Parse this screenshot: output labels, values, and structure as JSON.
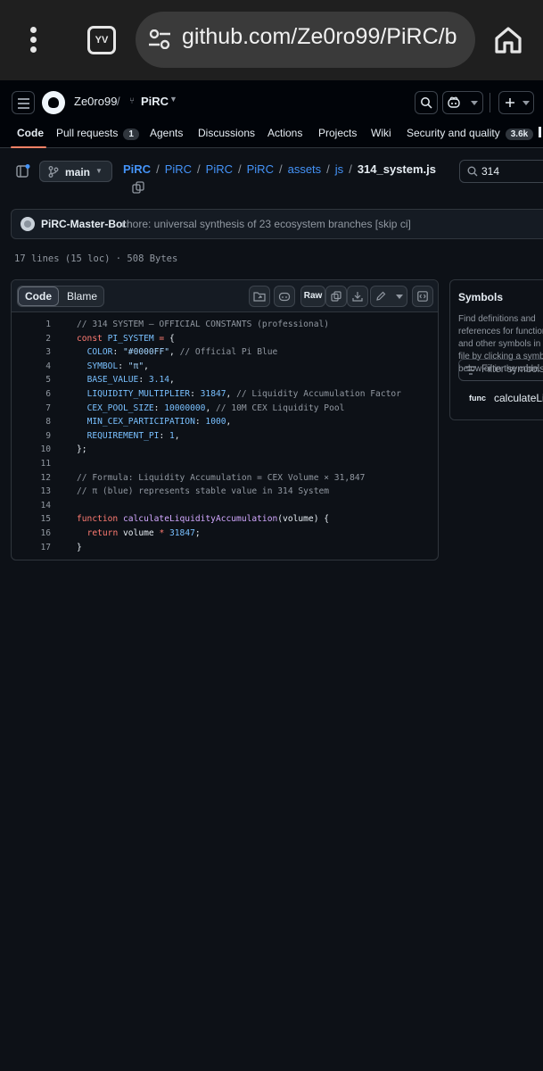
{
  "browser": {
    "url": "github.com/Ze0ro99/PiRC/b",
    "tab_icon_label": "YV"
  },
  "header": {
    "owner": "Ze0ro99",
    "repo": "PiRC"
  },
  "nav": {
    "code": "Code",
    "pull_requests": "Pull requests",
    "pull_requests_count": "1",
    "agents": "Agents",
    "discussions": "Discussions",
    "actions": "Actions",
    "projects": "Projects",
    "wiki": "Wiki",
    "security": "Security and quality",
    "security_count": "3.6k"
  },
  "file_nav": {
    "branch": "main",
    "breadcrumb": [
      "PiRC",
      "PiRC",
      "PiRC",
      "PiRC",
      "assets",
      "js"
    ],
    "file_name": "314_system.js",
    "search_value": "314"
  },
  "commit": {
    "author": "PiRC-Master-Bot",
    "message": "chore: universal synthesis of 23 ecosystem branches [skip ci]"
  },
  "file_meta": "17 lines (15 loc) · 508 Bytes",
  "code_view": {
    "tab_code": "Code",
    "tab_blame": "Blame",
    "raw_label": "Raw",
    "lines": [
      [
        {
          "c": "cm",
          "t": "// 314 SYSTEM – OFFICIAL CONSTANTS (professional)"
        }
      ],
      [
        {
          "c": "kw",
          "t": "const "
        },
        {
          "c": "cn",
          "t": "PI_SYSTEM"
        },
        {
          "c": "",
          "t": " "
        },
        {
          "c": "kw",
          "t": "="
        },
        {
          "c": "",
          "t": " {"
        }
      ],
      [
        {
          "c": "",
          "t": "  "
        },
        {
          "c": "cn",
          "t": "COLOR"
        },
        {
          "c": "",
          "t": ": "
        },
        {
          "c": "st",
          "t": "\"#0000FF\""
        },
        {
          "c": "",
          "t": ", "
        },
        {
          "c": "cm",
          "t": "// Official Pi Blue"
        }
      ],
      [
        {
          "c": "",
          "t": "  "
        },
        {
          "c": "cn",
          "t": "SYMBOL"
        },
        {
          "c": "",
          "t": ": "
        },
        {
          "c": "st",
          "t": "\"π\""
        },
        {
          "c": "",
          "t": ","
        }
      ],
      [
        {
          "c": "",
          "t": "  "
        },
        {
          "c": "cn",
          "t": "BASE_VALUE"
        },
        {
          "c": "",
          "t": ": "
        },
        {
          "c": "cn",
          "t": "3.14"
        },
        {
          "c": "",
          "t": ","
        }
      ],
      [
        {
          "c": "",
          "t": "  "
        },
        {
          "c": "cn",
          "t": "LIQUIDITY_MULTIPLIER"
        },
        {
          "c": "",
          "t": ": "
        },
        {
          "c": "cn",
          "t": "31847"
        },
        {
          "c": "",
          "t": ", "
        },
        {
          "c": "cm",
          "t": "// Liquidity Accumulation Factor"
        }
      ],
      [
        {
          "c": "",
          "t": "  "
        },
        {
          "c": "cn",
          "t": "CEX_POOL_SIZE"
        },
        {
          "c": "",
          "t": ": "
        },
        {
          "c": "cn",
          "t": "10000000"
        },
        {
          "c": "",
          "t": ", "
        },
        {
          "c": "cm",
          "t": "// 10M CEX Liquidity Pool"
        }
      ],
      [
        {
          "c": "",
          "t": "  "
        },
        {
          "c": "cn",
          "t": "MIN_CEX_PARTICIPATION"
        },
        {
          "c": "",
          "t": ": "
        },
        {
          "c": "cn",
          "t": "1000"
        },
        {
          "c": "",
          "t": ","
        }
      ],
      [
        {
          "c": "",
          "t": "  "
        },
        {
          "c": "cn",
          "t": "REQUIREMENT_PI"
        },
        {
          "c": "",
          "t": ": "
        },
        {
          "c": "cn",
          "t": "1"
        },
        {
          "c": "",
          "t": ","
        }
      ],
      [
        {
          "c": "",
          "t": "};"
        }
      ],
      [],
      [
        {
          "c": "cm",
          "t": "// Formula: Liquidity Accumulation = CEX Volume × 31,847"
        }
      ],
      [
        {
          "c": "cm",
          "t": "// π (blue) represents stable value in 314 System"
        }
      ],
      [],
      [
        {
          "c": "kw",
          "t": "function "
        },
        {
          "c": "fn",
          "t": "calculateLiquidityAccumulation"
        },
        {
          "c": "",
          "t": "(volume) {"
        }
      ],
      [
        {
          "c": "",
          "t": "  "
        },
        {
          "c": "kw",
          "t": "return"
        },
        {
          "c": "",
          "t": " volume "
        },
        {
          "c": "kw",
          "t": "*"
        },
        {
          "c": "",
          "t": " "
        },
        {
          "c": "cn",
          "t": "31847"
        },
        {
          "c": "",
          "t": ";"
        }
      ],
      [
        {
          "c": "",
          "t": "}"
        }
      ]
    ]
  },
  "symbols": {
    "title": "Symbols",
    "description": "Find definitions and references for functions and other symbols in this file by clicking a symbol below or in the code.",
    "filter_placeholder": "Filter symbols",
    "items": [
      {
        "kind": "func",
        "name": "calculateLiquidityAccumulation"
      }
    ]
  },
  "colors": {
    "accent_underline": "#f78166",
    "link": "#4493f8",
    "background": "#0d1117"
  }
}
